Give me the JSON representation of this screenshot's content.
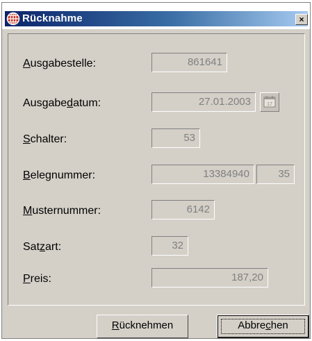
{
  "window": {
    "title": "Rücknahme",
    "close_glyph": "×"
  },
  "icons": {
    "title": "app-globe-icon",
    "calendar": "calendar-icon"
  },
  "fields": {
    "ausgabestelle": {
      "label_pre": "",
      "label_key": "A",
      "label_post": "usgabestelle:",
      "value": "861641"
    },
    "ausgabedatum": {
      "label_pre": "Ausgabe",
      "label_key": "d",
      "label_post": "atum:",
      "value": "27.01.2003",
      "calendar_glyph": "17"
    },
    "schalter": {
      "label_pre": "",
      "label_key": "S",
      "label_post": "chalter:",
      "value": "53"
    },
    "belegnummer": {
      "label_pre": "",
      "label_key": "B",
      "label_post": "elegnummer:",
      "value": "13384940",
      "value2": "35"
    },
    "musternummer": {
      "label_pre": "",
      "label_key": "M",
      "label_post": "usternummer:",
      "value": "6142"
    },
    "satzart": {
      "label_pre": "Sat",
      "label_key": "z",
      "label_post": "art:",
      "value": "32"
    },
    "preis": {
      "label_pre": "",
      "label_key": "P",
      "label_post": "reis:",
      "value": "187,20"
    }
  },
  "buttons": {
    "ruecknehmen": {
      "pre": "",
      "key": "R",
      "post": "ücknehmen"
    },
    "abbrechen": {
      "pre": "Abbre",
      "key": "c",
      "post": "hen"
    }
  }
}
